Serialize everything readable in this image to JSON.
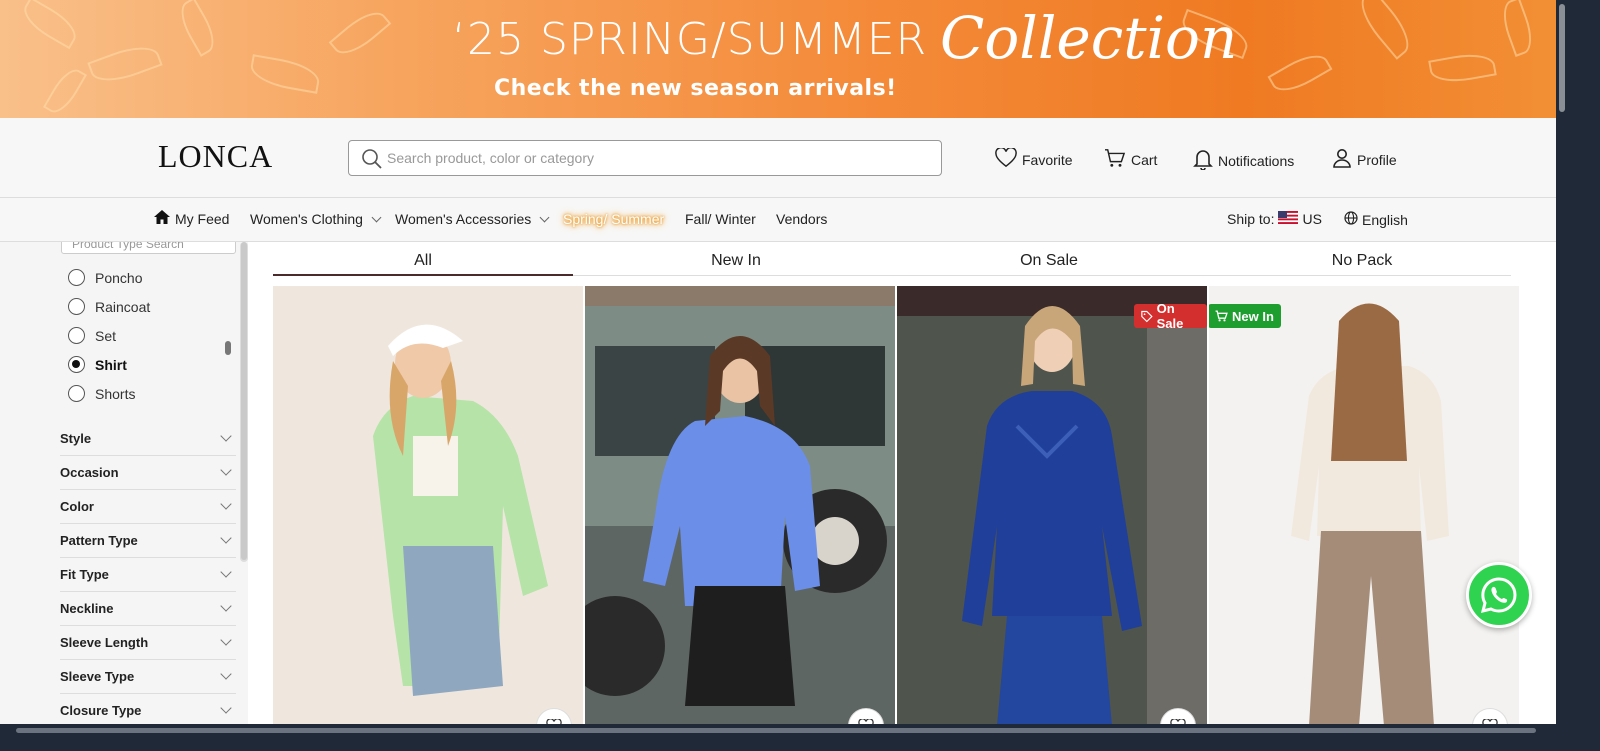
{
  "banner": {
    "title": "‘25 SPRING/SUMMER",
    "script": "Collection",
    "subtitle": "Check the new season arrivals!"
  },
  "header": {
    "logo": "LONCA",
    "search_placeholder": "Search product, color or category",
    "favorite": "Favorite",
    "cart": "Cart",
    "notifications": "Notifications",
    "profile": "Profile"
  },
  "nav": {
    "my_feed": "My Feed",
    "womens_clothing": "Women's Clothing",
    "womens_accessories": "Women's Accessories",
    "spring_summer": "Spring/ Summer",
    "fall_winter": "Fall/ Winter",
    "vendors": "Vendors",
    "ship_to_label": "Ship to:",
    "ship_to_country": "US",
    "language": "English"
  },
  "sidebar": {
    "search_placeholder": "Product Type Search",
    "product_types": [
      {
        "label": "Poncho",
        "selected": false
      },
      {
        "label": "Raincoat",
        "selected": false
      },
      {
        "label": "Set",
        "selected": false
      },
      {
        "label": "Shirt",
        "selected": true
      },
      {
        "label": "Shorts",
        "selected": false
      }
    ],
    "filters": [
      "Style",
      "Occasion",
      "Color",
      "Pattern Type",
      "Fit Type",
      "Neckline",
      "Sleeve Length",
      "Sleeve Type",
      "Closure Type"
    ]
  },
  "tabs": [
    {
      "label": "All",
      "active": true
    },
    {
      "label": "New In",
      "active": false
    },
    {
      "label": "On Sale",
      "active": false
    },
    {
      "label": "No Pack",
      "active": false
    }
  ],
  "badges": {
    "on_sale": "On Sale",
    "new_in": "New In"
  },
  "colors": {
    "on_sale_badge": "#d32f2f",
    "new_in_badge": "#1e9e2e",
    "whatsapp": "#2fd34f",
    "banner_orange": "#ef7a22"
  }
}
